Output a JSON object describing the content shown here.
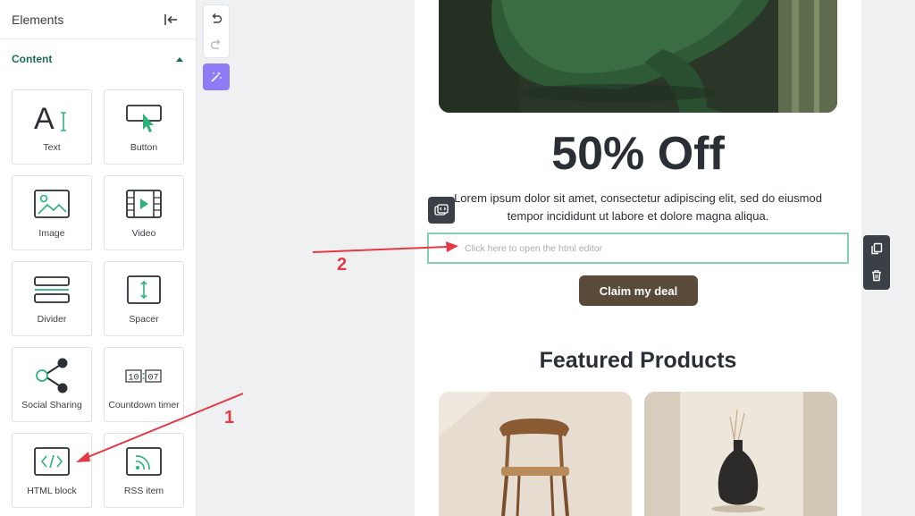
{
  "sidebar": {
    "title": "Elements",
    "collapse_icon": "collapse-left-icon",
    "section": {
      "label": "Content",
      "expanded": true
    },
    "items": [
      {
        "label": "Text",
        "icon": "text-icon"
      },
      {
        "label": "Button",
        "icon": "button-icon"
      },
      {
        "label": "Image",
        "icon": "image-icon"
      },
      {
        "label": "Video",
        "icon": "video-icon"
      },
      {
        "label": "Divider",
        "icon": "divider-icon"
      },
      {
        "label": "Spacer",
        "icon": "spacer-icon"
      },
      {
        "label": "Social Sharing",
        "icon": "share-icon"
      },
      {
        "label": "Countdown timer",
        "icon": "countdown-icon",
        "digits": [
          "10",
          "07"
        ]
      },
      {
        "label": "HTML block",
        "icon": "code-icon"
      },
      {
        "label": "RSS item",
        "icon": "rss-icon"
      }
    ]
  },
  "toolbar": {
    "undo_icon": "undo-icon",
    "redo_icon": "redo-icon",
    "magic_icon": "magic-wand-icon"
  },
  "email": {
    "headline": "50% Off",
    "body": "Lorem ipsum dolor sit amet, consectetur adipiscing elit, sed do eiusmod tempor incididunt ut labore et dolore magna aliqua.",
    "html_placeholder": "Click here to open the html editor",
    "cta": "Claim my deal",
    "section_title": "Featured Products"
  },
  "annotations": {
    "step1": "1",
    "step2": "2"
  },
  "colors": {
    "accent_green": "#1e6b5a",
    "icon_green": "#2bb37a",
    "magic_purple": "#8d7cf5",
    "cta_brown": "#5a4a3a",
    "selection_green": "#83d1ad",
    "annotation_red": "#e53945"
  }
}
